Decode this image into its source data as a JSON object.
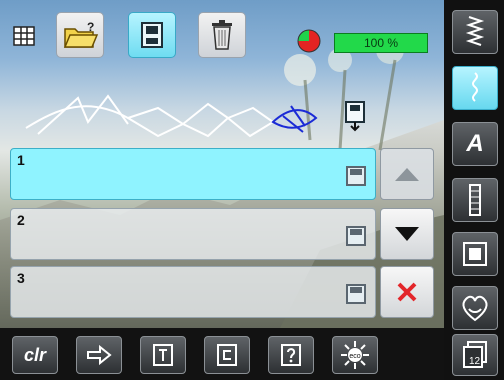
{
  "progress": {
    "percent_label": "100 %",
    "used_fraction": 0.75
  },
  "memory_slots": [
    {
      "label": "1",
      "selected": true
    },
    {
      "label": "2",
      "selected": false
    },
    {
      "label": "3",
      "selected": false
    }
  ],
  "bottom_toolbar": {
    "clear_label": "clr"
  },
  "sidebar": {
    "alphabet_label": "A",
    "page_badge": "12"
  },
  "colors": {
    "accent": "#7fe8fb",
    "progress_green": "#22d94a",
    "delete_red": "#e3262a",
    "pattern_blue": "#1b2bd6"
  }
}
